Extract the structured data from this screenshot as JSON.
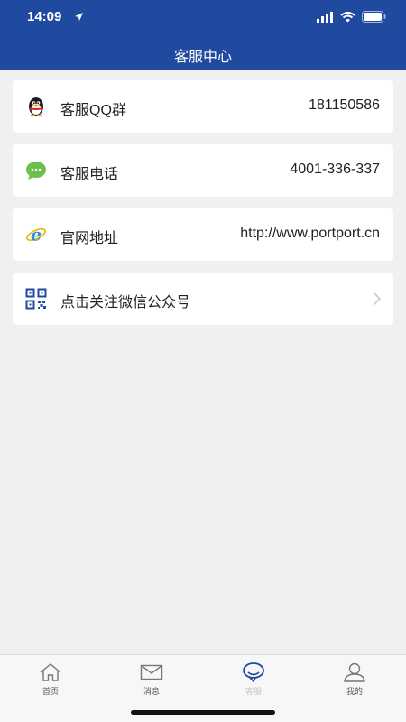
{
  "status": {
    "time": "14:09"
  },
  "header": {
    "title": "客服中心"
  },
  "items": [
    {
      "label": "客服QQ群",
      "value": "181150586",
      "icon": "qq-penguin-icon"
    },
    {
      "label": "客服电话",
      "value": "4001-336-337",
      "icon": "chat-bubble-icon"
    },
    {
      "label": "官网地址",
      "value": "http://www.portport.cn",
      "icon": "ie-browser-icon"
    },
    {
      "label": "点击关注微信公众号",
      "value": "",
      "icon": "qr-code-icon"
    }
  ],
  "tabs": [
    {
      "label": "首页",
      "icon": "home-icon"
    },
    {
      "label": "消息",
      "icon": "mail-icon"
    },
    {
      "label": "客服",
      "icon": "service-icon",
      "active": true
    },
    {
      "label": "我的",
      "icon": "user-icon"
    }
  ],
  "colors": {
    "header": "#1f4aa0",
    "background": "#f0f0f0"
  }
}
